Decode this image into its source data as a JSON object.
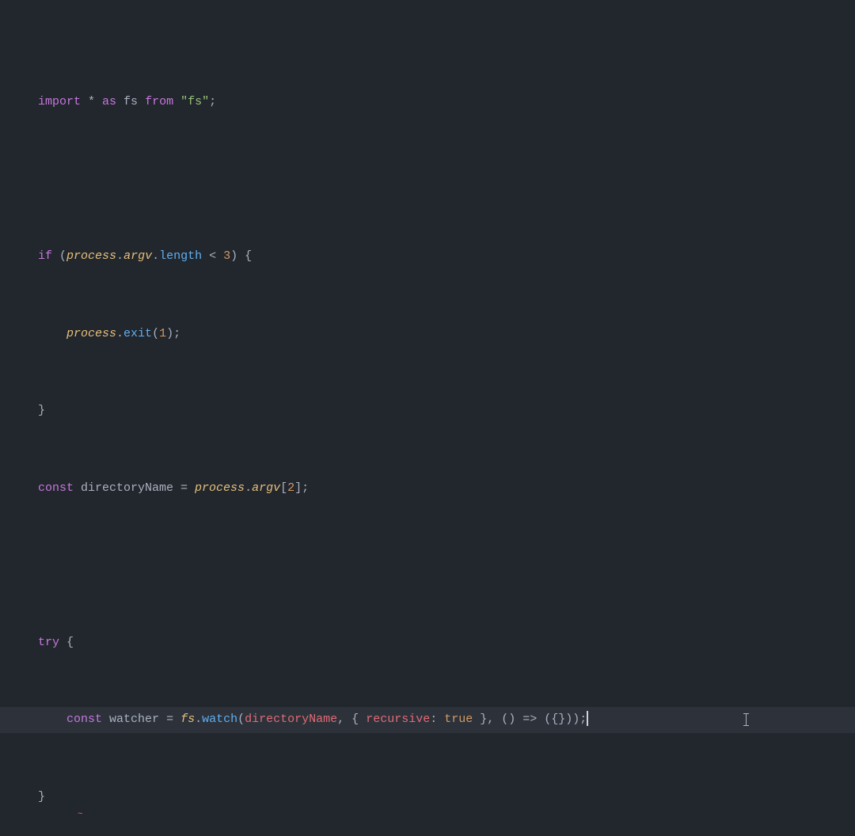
{
  "colors": {
    "bg": "#22262d",
    "highlight": "#2c313a",
    "default": "#abb2bf",
    "keyword": "#c678dd",
    "var_italic": "#e5c07b",
    "prop": "#61afef",
    "num": "#d19a66",
    "string": "#98c379",
    "varname": "#e06c75"
  },
  "lines": {
    "l1": {
      "t1": "import",
      "t2": " * ",
      "t3": "as",
      "t4": " fs ",
      "t5": "from",
      "t6": " ",
      "t7": "\"fs\"",
      "t8": ";"
    },
    "l3": {
      "t1": "if",
      "t2": " (",
      "t3": "process",
      "t4": ".",
      "t5": "argv",
      "t6": ".",
      "t7": "length",
      "t8": " < ",
      "t9": "3",
      "t10": ") {"
    },
    "l4": {
      "t1": "    ",
      "t2": "process",
      "t3": ".",
      "t4": "exit",
      "t5": "(",
      "t6": "1",
      "t7": ");"
    },
    "l5": {
      "t1": "}"
    },
    "l6": {
      "t1": "const",
      "t2": " directoryName = ",
      "t3": "process",
      "t4": ".",
      "t5": "argv",
      "t6": "[",
      "t7": "2",
      "t8": "];"
    },
    "l8": {
      "t1": "try",
      "t2": " {"
    },
    "l9": {
      "t1": "    ",
      "t2": "const",
      "t3": " ",
      "t4": "watcher",
      "t5": " = ",
      "t6": "fs",
      "t7": ".",
      "t8": "watch",
      "t9": "(",
      "t10": "directoryName",
      "t11": ", { ",
      "t12": "recursive",
      "t13": ": ",
      "t14": "true",
      "t15": " }, () => ({}));"
    },
    "l10": {
      "t1": "}"
    }
  },
  "tilde": "~"
}
